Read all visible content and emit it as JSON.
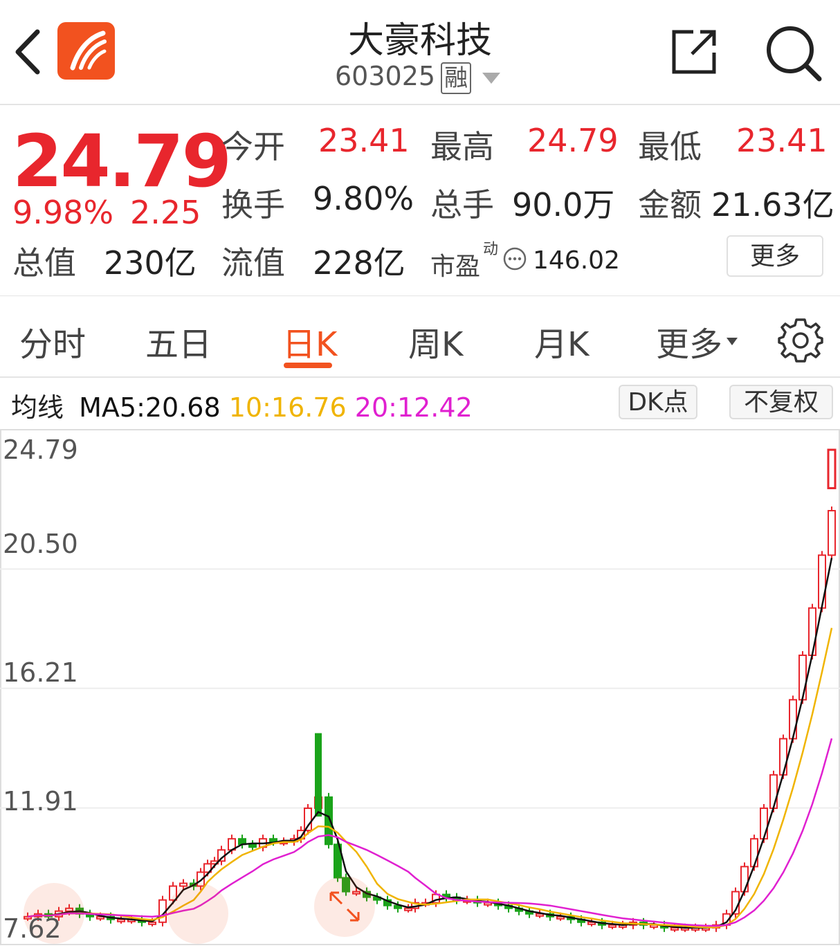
{
  "header": {
    "title": "大豪科技",
    "code": "603025",
    "margin_badge": "融"
  },
  "quote": {
    "price": "24.79",
    "change_pct": "9.98%",
    "change": "2.25",
    "open_label": "今开",
    "open": "23.41",
    "high_label": "最高",
    "high": "24.79",
    "low_label": "最低",
    "low": "23.41",
    "turnover_label": "换手",
    "turnover": "9.80%",
    "volume_label": "总手",
    "volume": "90.0万",
    "amount_label": "金额",
    "amount": "21.63亿",
    "total_cap_label": "总值",
    "total_cap": "230亿",
    "float_cap_label": "流值",
    "float_cap": "228亿",
    "pe_label": "市盈",
    "pe_sup": "动",
    "pe": "146.02",
    "more_label": "更多"
  },
  "tabs": {
    "items": [
      "分时",
      "五日",
      "日K",
      "周K",
      "月K",
      "更多"
    ],
    "active": "日K"
  },
  "ma": {
    "label": "均线",
    "ma5": "MA5:20.68",
    "ma10": "10:16.76",
    "ma20": "20:12.42",
    "dk_button": "DK点",
    "adjust_button": "不复权",
    "colors": {
      "ma5": "#111111",
      "ma10": "#f0b400",
      "ma20": "#e020d0"
    }
  },
  "chart_data": {
    "type": "candlestick",
    "y_ticks": [
      "24.79",
      "20.50",
      "16.21",
      "11.91",
      "7.62"
    ],
    "ylim": [
      7.62,
      24.79
    ],
    "grid": true,
    "up_color": "#e8262d",
    "down_color": "#1aa31a",
    "series": [
      {
        "name": "MA5",
        "color": "#111111"
      },
      {
        "name": "MA10",
        "color": "#f0b400"
      },
      {
        "name": "MA20",
        "color": "#e020d0"
      }
    ]
  },
  "colors": {
    "accent": "#f2521f",
    "up": "#e8262d",
    "down": "#1aa31a"
  },
  "icons": [
    "back-icon",
    "app-logo-icon",
    "share-icon",
    "search-icon",
    "more-circle-icon",
    "gear-icon"
  ]
}
